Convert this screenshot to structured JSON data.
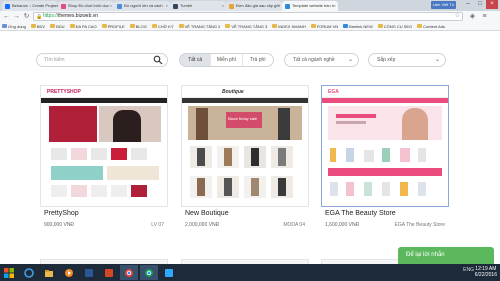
{
  "browser": {
    "tabs": [
      {
        "label": "Behance :: Create Project"
      },
      {
        "label": "Shop Đồ chơi bình dục"
      },
      {
        "label": "Đồ người lớn và cách"
      },
      {
        "label": "Tumblr"
      },
      {
        "label": "Đơn đảo giá sau xây gửi"
      },
      {
        "label": "Template website bán h",
        "active": true
      }
    ],
    "user_tag": "Lâm Viết Tú",
    "url_scheme": "https://",
    "url_host": "themes.bizweb.vn",
    "bookmarks": [
      "Ứng dụng",
      "BDV",
      "BDU",
      "ĐA PA CAO",
      "PROFILE",
      "BLOG",
      "CHỮ KÝ",
      "VẼ TRANG TĂNG 2",
      "VẼ TRANG TĂNG 3",
      "INDEX NHANH",
      "FORUM VN",
      "Beelink NEW",
      "CÔNG CỤ SEO",
      "Content Ads"
    ]
  },
  "filters": {
    "search_placeholder": "Tìm kiếm",
    "segments": [
      "Tất cả",
      "Miễn phí",
      "Trả phí"
    ],
    "category_label": "Tất cả ngành nghề",
    "sort_label": "Sắp xếp"
  },
  "themes": [
    {
      "name": "PrettyShop",
      "price": "900,000 VNĐ",
      "shop": "LV 07",
      "logo": "PRETTYSHOP"
    },
    {
      "name": "New Boutique",
      "price": "2,000,000 VNĐ",
      "shop": "MODA 04",
      "logo": "Boutique",
      "banner": "Black friday sale"
    },
    {
      "name": "EGA The Beauty Store",
      "price": "1,600,000 VNĐ",
      "shop": "EGA The Beauty Store",
      "logo": "EGA"
    }
  ],
  "chat": {
    "label": "Để lại lời nhắn"
  },
  "taskbar": {
    "tray": "ENG",
    "time": "12:19 AM",
    "date": "6/22/2016"
  },
  "colors": {
    "chat_green": "#5cb85c",
    "taskbar": "#1c2a3a",
    "url_green": "#1c9e4a",
    "pretty_accent": "#c2185b",
    "ega_pink": "#ea4c7e"
  }
}
